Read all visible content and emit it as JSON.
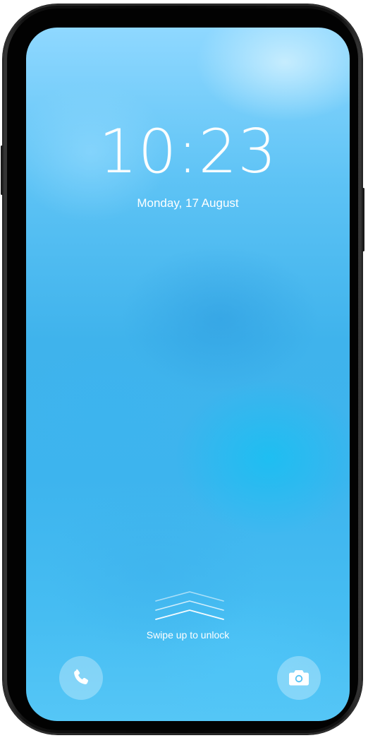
{
  "lock_screen": {
    "time": "10:23",
    "date": "Monday, 17 August",
    "unlock_hint": "Swipe up to unlock"
  },
  "shortcuts": {
    "left_icon": "phone-icon",
    "right_icon": "camera-icon"
  },
  "colors": {
    "wallpaper": "#45b9f0",
    "bezel": "#0a0a0a",
    "text": "#ffffff"
  }
}
